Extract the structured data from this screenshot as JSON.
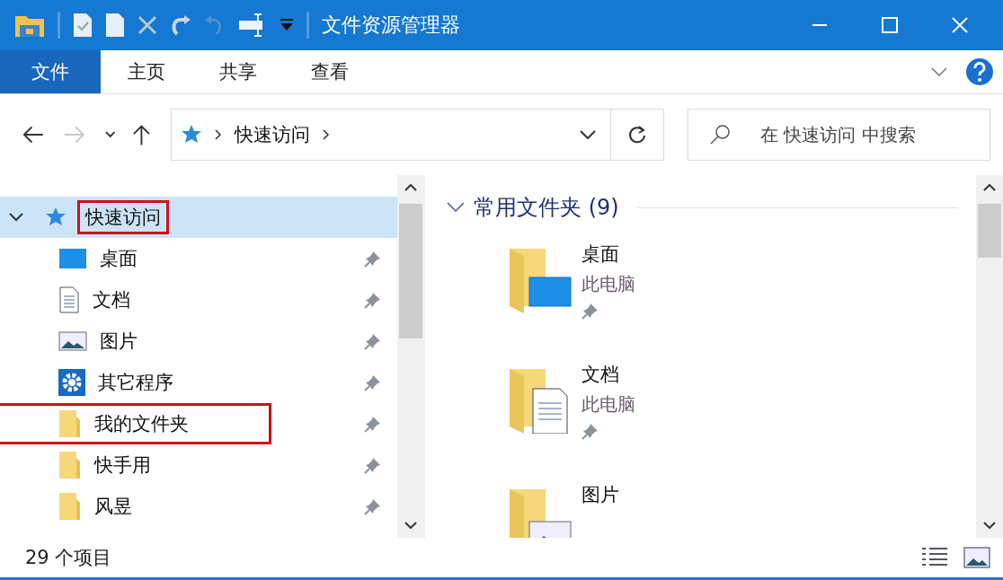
{
  "window": {
    "title": "文件资源管理器"
  },
  "ribbon_tabs": [
    {
      "label": "文件",
      "kind": "menu"
    },
    {
      "label": "主页",
      "kind": "tab"
    },
    {
      "label": "共享",
      "kind": "tab"
    },
    {
      "label": "查看",
      "kind": "tab"
    }
  ],
  "nav_buttons": [
    {
      "kind": "back",
      "disabled": false
    },
    {
      "kind": "forward",
      "disabled": true
    },
    {
      "kind": "recent",
      "disabled": false
    },
    {
      "kind": "up",
      "disabled": false
    }
  ],
  "address": {
    "path": [
      "快速访问"
    ]
  },
  "search": {
    "placeholder": "在 快速访问 中搜索"
  },
  "nav_pane": [
    {
      "label": "快速访问",
      "kind": "star",
      "selected": true,
      "expanded": true,
      "annotated": true,
      "children": [
        {
          "label": "桌面",
          "kind": "desktop",
          "selected": false,
          "pinned": true,
          "annotated": false
        },
        {
          "label": "文档",
          "kind": "document",
          "selected": false,
          "pinned": true,
          "annotated": false
        },
        {
          "label": "图片",
          "kind": "picture",
          "selected": false,
          "pinned": true,
          "annotated": false
        },
        {
          "label": "其它程序",
          "kind": "gear",
          "selected": false,
          "pinned": true,
          "annotated": false
        },
        {
          "label": "我的文件夹",
          "kind": "folder",
          "selected": false,
          "pinned": true,
          "annotated": true
        },
        {
          "label": "快手用",
          "kind": "folder",
          "selected": false,
          "pinned": true,
          "annotated": false
        },
        {
          "label": "风昱",
          "kind": "folder",
          "selected": false,
          "pinned": true,
          "annotated": false
        }
      ]
    }
  ],
  "content": {
    "group": {
      "title": "常用文件夹 (9)",
      "expanded": true
    },
    "items": [
      {
        "name": "桌面",
        "location": "此电脑",
        "kind": "desktop",
        "pinned": true
      },
      {
        "name": "文档",
        "location": "此电脑",
        "kind": "document",
        "pinned": true
      },
      {
        "name": "图片",
        "kind": "picture",
        "pinned": false
      }
    ]
  },
  "status_bar": {
    "count": "29 个项目"
  }
}
